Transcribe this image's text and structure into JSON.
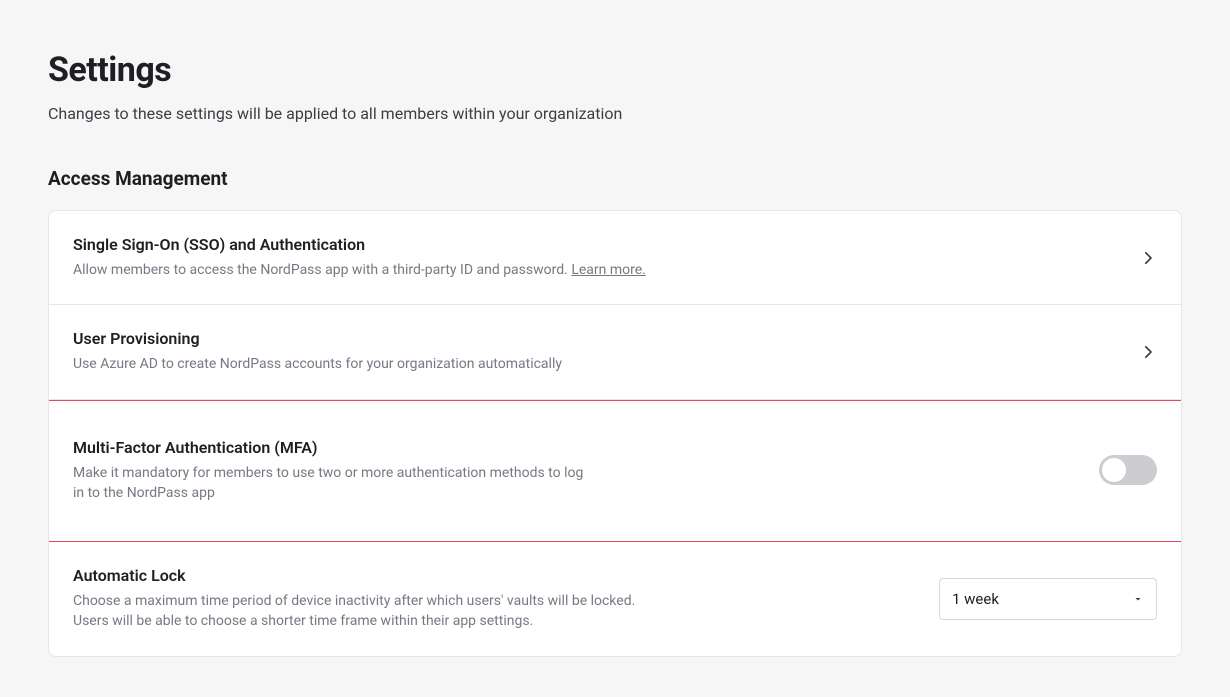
{
  "page": {
    "title": "Settings",
    "subtitle": "Changes to these settings will be applied to all members within your organization"
  },
  "section": {
    "title": "Access Management"
  },
  "rows": {
    "sso": {
      "title": "Single Sign-On (SSO) and Authentication",
      "desc_prefix": "Allow members to access the NordPass app with a third-party ID and password. ",
      "learn_more": "Learn more."
    },
    "provisioning": {
      "title": "User Provisioning",
      "desc": "Use Azure AD to create NordPass accounts for your organization automatically"
    },
    "mfa": {
      "title": "Multi-Factor Authentication (MFA)",
      "desc": "Make it mandatory for members to use two or more authentication methods to log in to the NordPass app",
      "enabled": false
    },
    "autolock": {
      "title": "Automatic Lock",
      "desc": "Choose a maximum time period of device inactivity after which users' vaults will be locked. Users will be able to choose a shorter time frame within their app settings.",
      "selected": "1 week"
    }
  }
}
